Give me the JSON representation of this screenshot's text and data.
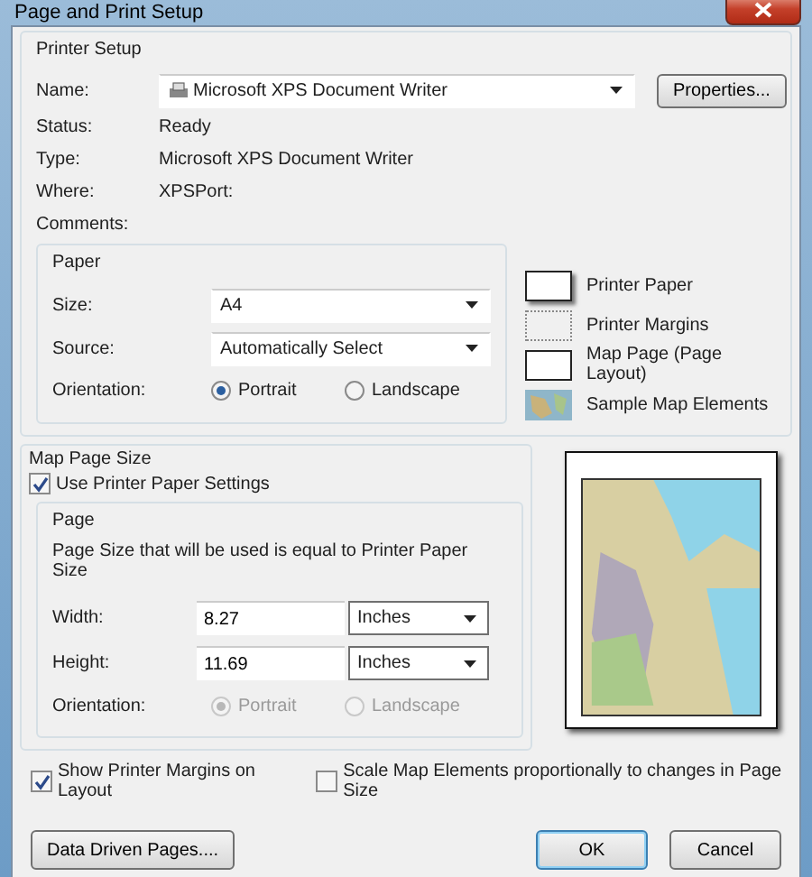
{
  "window": {
    "title": "Page and Print Setup"
  },
  "printer_setup": {
    "title": "Printer Setup",
    "name": {
      "label": "Name:",
      "value": "Microsoft XPS Document Writer"
    },
    "properties_button": "Properties...",
    "info": [
      {
        "label": "Status:",
        "value": "Ready"
      },
      {
        "label": "Type:",
        "value": "Microsoft XPS Document Writer"
      },
      {
        "label": "Where:",
        "value": "XPSPort:"
      },
      {
        "label": "Comments:"
      }
    ],
    "paper": {
      "title": "Paper",
      "size": {
        "label": "Size:",
        "value": "A4"
      },
      "source": {
        "label": "Source:",
        "value": "Automatically Select"
      },
      "orientation": {
        "label": "Orientation:",
        "disabled": false,
        "options": [
          {
            "label": "Portrait",
            "selected": true
          },
          {
            "label": "Landscape",
            "selected": false
          }
        ]
      }
    },
    "legend": [
      {
        "kind": "paper",
        "label": "Printer Paper"
      },
      {
        "kind": "margins",
        "label": "Printer Margins"
      },
      {
        "kind": "page",
        "label": "Map Page (Page Layout)"
      },
      {
        "kind": "sample",
        "label": "Sample Map Elements"
      }
    ]
  },
  "map_page_size": {
    "title": "Map Page Size",
    "use_printer_paper": {
      "label": "Use Printer Paper Settings",
      "checked": true
    },
    "page": {
      "title": "Page",
      "note": "Page Size that will be used is equal to Printer Paper Size",
      "width": {
        "label": "Width:",
        "value": "8.27",
        "unit": "Inches"
      },
      "height": {
        "label": "Height:",
        "value": "11.69",
        "unit": "Inches"
      },
      "orientation": {
        "label": "Orientation:",
        "disabled": true,
        "options": [
          {
            "label": "Portrait",
            "selected": true
          },
          {
            "label": "Landscape",
            "selected": false
          }
        ]
      }
    }
  },
  "options": [
    {
      "label": "Show Printer Margins on Layout",
      "checked": true
    },
    {
      "label": "Scale Map Elements proportionally to changes in Page Size",
      "checked": false
    }
  ],
  "buttons": [
    {
      "label": "Data Driven Pages....",
      "default": false
    },
    {
      "label": "OK",
      "default": true
    },
    {
      "label": "Cancel",
      "default": false
    }
  ]
}
